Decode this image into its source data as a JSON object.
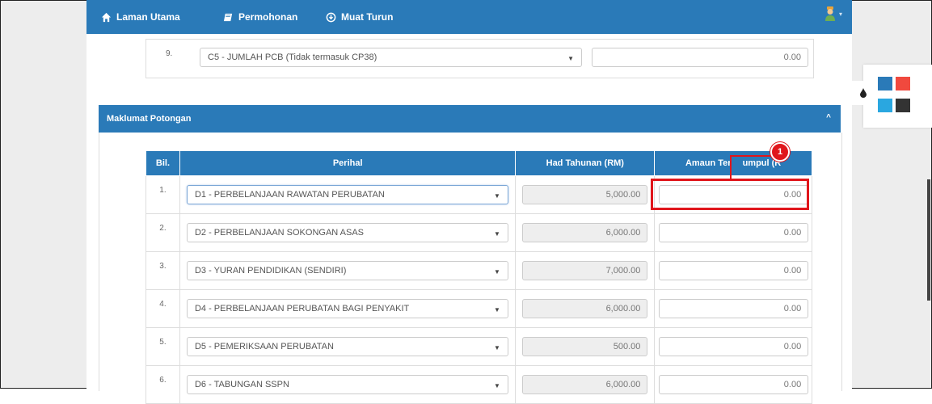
{
  "nav": {
    "home": "Laman Utama",
    "apply": "Permohonan",
    "download": "Muat Turun"
  },
  "top_row": {
    "number": "9.",
    "select_value": "C5 - JUMLAH PCB (Tidak termasuk CP38)",
    "amount": "0.00"
  },
  "section": {
    "title": "Maklumat Potongan"
  },
  "table": {
    "headers": [
      "Bil.",
      "Perihal",
      "Had Tahunan (RM)",
      "Amaun Terkumpul (RM)"
    ],
    "header_visible": [
      "Bil.",
      "Perihal",
      "Had Tahunan (RM)",
      "Amaun Ter",
      "umpul (R"
    ],
    "rows": [
      {
        "no": "1.",
        "perihal": "D1 - PERBELANJAAN RAWATAN PERUBATAN",
        "had": "5,000.00",
        "amaun": "0.00"
      },
      {
        "no": "2.",
        "perihal": "D2 - PERBELANJAAN SOKONGAN ASAS",
        "had": "6,000.00",
        "amaun": "0.00"
      },
      {
        "no": "3.",
        "perihal": "D3 - YURAN PENDIDIKAN (SENDIRI)",
        "had": "7,000.00",
        "amaun": "0.00"
      },
      {
        "no": "4.",
        "perihal": "D4 - PERBELANJAAN PERUBATAN BAGI PENYAKIT",
        "had": "6,000.00",
        "amaun": "0.00"
      },
      {
        "no": "5.",
        "perihal": "D5 - PEMERIKSAAN PERUBATAN",
        "had": "500.00",
        "amaun": "0.00"
      },
      {
        "no": "6.",
        "perihal": "D6 - TABUNGAN SSPN",
        "had": "6,000.00",
        "amaun": "0.00"
      }
    ]
  },
  "callout": {
    "number": "1"
  },
  "palette": {
    "colors": [
      "#2a7ab8",
      "#f0493e",
      "#2aa7e0",
      "#333333"
    ]
  },
  "colors": {
    "primary": "#2a7ab8",
    "highlight": "#e0161c"
  }
}
